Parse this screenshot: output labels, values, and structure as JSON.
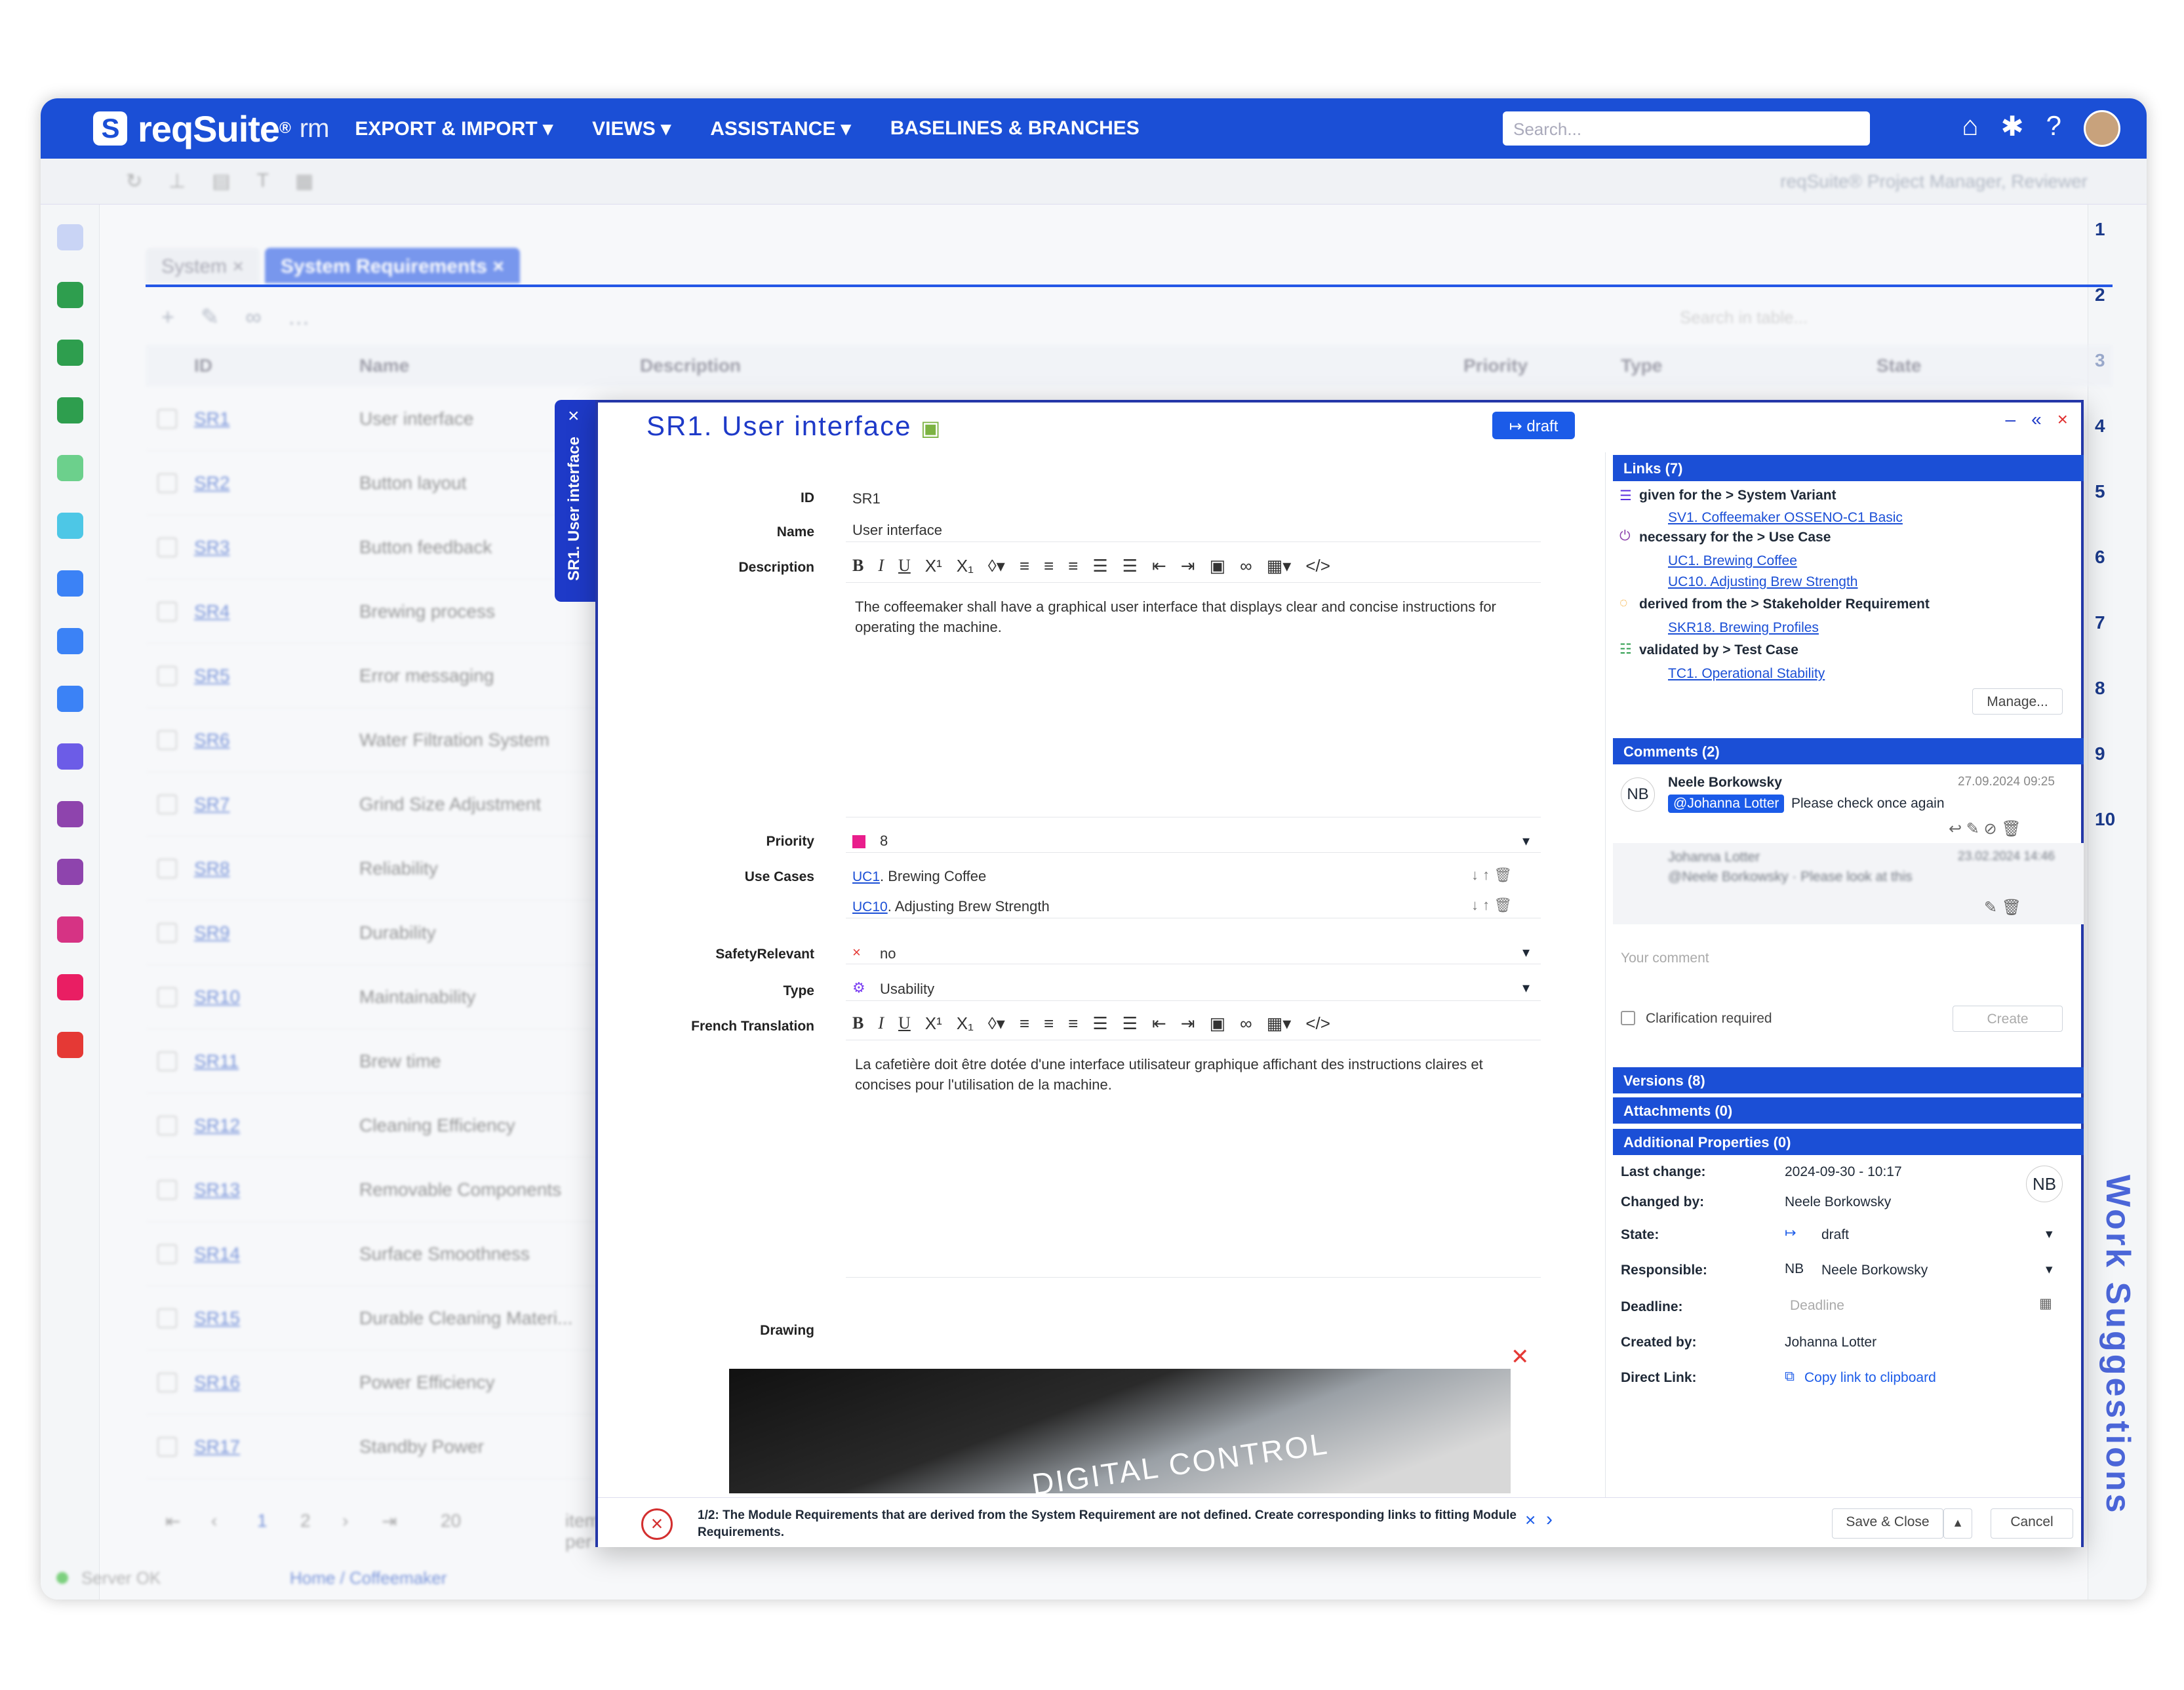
{
  "app": {
    "logo": "reqSuite",
    "logo_sup": "®",
    "logo_sub": "rm",
    "menu": [
      "EXPORT & IMPORT ▾",
      "VIEWS ▾",
      "ASSISTANCE ▾",
      "BASELINES & BRANCHES"
    ],
    "search_placeholder": "Search...",
    "role": "reqSuite® Project Manager, Reviewer"
  },
  "tabs": [
    {
      "label": "System ×"
    },
    {
      "label": "System Requirements ×"
    }
  ],
  "table": {
    "search_placeholder": "Search in table...",
    "columns": [
      "ID",
      "Name",
      "Description",
      "Priority",
      "Type",
      "State"
    ],
    "rows": [
      {
        "id": "SR1",
        "name": "User interface"
      },
      {
        "id": "SR2",
        "name": "Button layout"
      },
      {
        "id": "SR3",
        "name": "Button feedback"
      },
      {
        "id": "SR4",
        "name": "Brewing process"
      },
      {
        "id": "SR5",
        "name": "Error messaging"
      },
      {
        "id": "SR6",
        "name": "Water Filtration System"
      },
      {
        "id": "SR7",
        "name": "Grind Size Adjustment"
      },
      {
        "id": "SR8",
        "name": "Reliability"
      },
      {
        "id": "SR9",
        "name": "Durability"
      },
      {
        "id": "SR10",
        "name": "Maintainability"
      },
      {
        "id": "SR11",
        "name": "Brew time"
      },
      {
        "id": "SR12",
        "name": "Cleaning Efficiency"
      },
      {
        "id": "SR13",
        "name": "Removable Components"
      },
      {
        "id": "SR14",
        "name": "Surface Smoothness"
      },
      {
        "id": "SR15",
        "name": "Durable Cleaning Materi..."
      },
      {
        "id": "SR16",
        "name": "Power Efficiency"
      },
      {
        "id": "SR17",
        "name": "Standby Power"
      }
    ],
    "pager": {
      "pages": [
        "1",
        "2"
      ],
      "page_size": "20",
      "items_label": "items per"
    }
  },
  "status_bar": {
    "server": "Server OK",
    "breadcrumb": "Home / Coffeemaker"
  },
  "right_rail": {
    "numbers": [
      "1",
      "2",
      "3",
      "4",
      "5",
      "6",
      "7",
      "8",
      "9",
      "10"
    ],
    "work_suggestions": "Work Suggestions"
  },
  "modal": {
    "side_tab": "SR1. User interface",
    "title": "SR1. User interface",
    "draft_badge": "↦ draft",
    "fields": {
      "id_label": "ID",
      "id_value": "SR1",
      "name_label": "Name",
      "name_value": "User interface",
      "description_label": "Description",
      "description": "The coffeemaker shall have a graphical user interface that displays clear and concise instructions for operating the machine.",
      "priority_label": "Priority",
      "priority_value": "8",
      "use_cases_label": "Use Cases",
      "use_case_1_id": "UC1",
      "use_case_1_name": ". Brewing Coffee",
      "use_case_2_id": "UC10",
      "use_case_2_name": ". Adjusting Brew Strength",
      "safety_label": "SafetyRelevant",
      "safety_value": "no",
      "type_label": "Type",
      "type_value": "Usability",
      "french_label": "French Translation",
      "french": "La cafetière doit être dotée d'une interface utilisateur graphique affichant des instructions claires et concises pour l'utilisation de la machine.",
      "drawing_label": "Drawing",
      "drawing_text": "DIGITAL CONTROL"
    },
    "links": {
      "header": "Links (7)",
      "groups": [
        {
          "relation": "given for the > System Variant",
          "items": [
            "SV1. Coffeemaker OSSENO-C1 Basic"
          ]
        },
        {
          "relation": "necessary for the > Use Case",
          "items": [
            "UC1. Brewing Coffee",
            "UC10. Adjusting Brew Strength"
          ]
        },
        {
          "relation": "derived from the > Stakeholder Requirement",
          "items": [
            "SKR18. Brewing Profiles"
          ]
        },
        {
          "relation": "validated by > Test Case",
          "items": [
            "TC1. Operational Stability"
          ]
        }
      ],
      "manage_button": "Manage..."
    },
    "comments": {
      "header": "Comments (2)",
      "c1_initials": "NB",
      "c1_author": "Neele Borkowsky",
      "c1_date": "27.09.2024 09:25",
      "c1_mention": "@Johanna Lotter",
      "c1_text": "Please check once again",
      "c2_author": "Johanna Lotter",
      "c2_date": "23.02.2024 14:46",
      "c2_text": "@Neele Borkowsky · Please look at this",
      "placeholder": "Your comment",
      "clarification": "Clarification required",
      "create_button": "Create"
    },
    "versions": "Versions (8)",
    "attachments": "Attachments (0)",
    "additional": {
      "header": "Additional Properties (0)",
      "last_change_label": "Last change:",
      "last_change": "2024-09-30 - 10:17",
      "changed_by_label": "Changed by:",
      "changed_by": "Neele Borkowsky",
      "state_label": "State:",
      "state": "draft",
      "responsible_label": "Responsible:",
      "responsible_initials": "NB",
      "responsible": "Neele Borkowsky",
      "deadline_label": "Deadline:",
      "deadline_placeholder": "Deadline",
      "created_by_label": "Created by:",
      "created_by": "Johanna Lotter",
      "direct_link_label": "Direct Link:",
      "direct_link": "Copy link to clipboard",
      "avatar_initials": "NB"
    },
    "footer": {
      "error_counter": "1/2:",
      "error_text": "The Module Requirements that are derived from the System Requirement are not defined. Create corresponding links to fitting Module Requirements.",
      "save_close": "Save & Close",
      "cancel": "Cancel"
    }
  },
  "colors": {
    "brand": "#1b4fd6",
    "modal_border": "#2437a8",
    "priority": "#e91e8c",
    "error": "#d32f2f"
  }
}
